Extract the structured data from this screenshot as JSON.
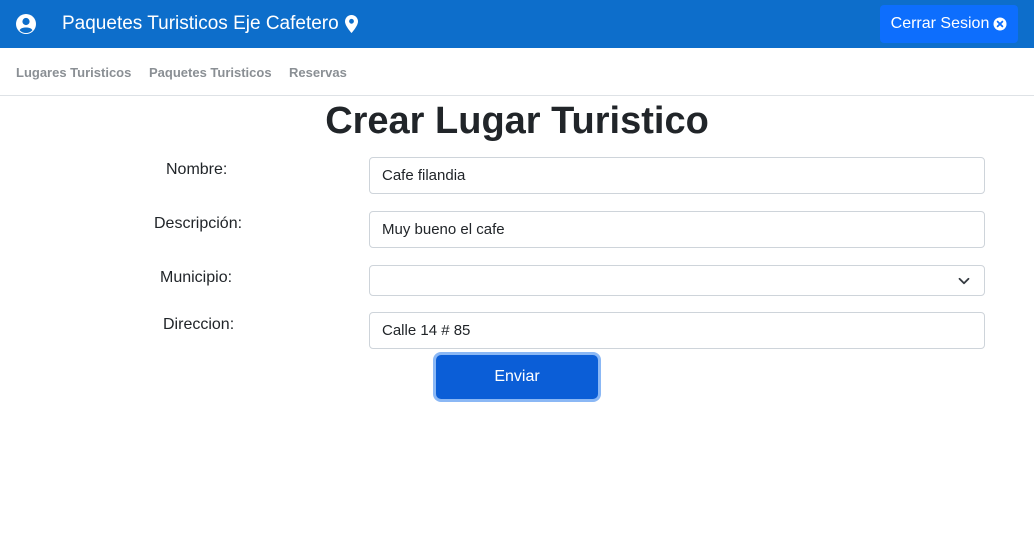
{
  "header": {
    "brand": "Paquetes Turisticos Eje Cafetero",
    "logout_label": "Cerrar Sesion",
    "bg_color": "#0d6ecb",
    "icons": [
      "user-circle-icon",
      "map-pin-icon",
      "close-circle-icon"
    ]
  },
  "nav": {
    "items": [
      {
        "label": "Lugares Turisticos"
      },
      {
        "label": "Paquetes Turisticos"
      },
      {
        "label": "Reservas"
      }
    ]
  },
  "form": {
    "title": "Crear Lugar Turistico",
    "nombre": {
      "label": "Nombre:",
      "value": "Cafe filandia"
    },
    "descripcion": {
      "label": "Descripción:",
      "value": "Muy bueno el cafe"
    },
    "municipio": {
      "label": "Municipio:",
      "value": ""
    },
    "direccion": {
      "label": "Direccion:",
      "value": "Calle 14 # 85"
    },
    "submit_label": "Enviar",
    "submit_color": "#0b5ed7"
  }
}
